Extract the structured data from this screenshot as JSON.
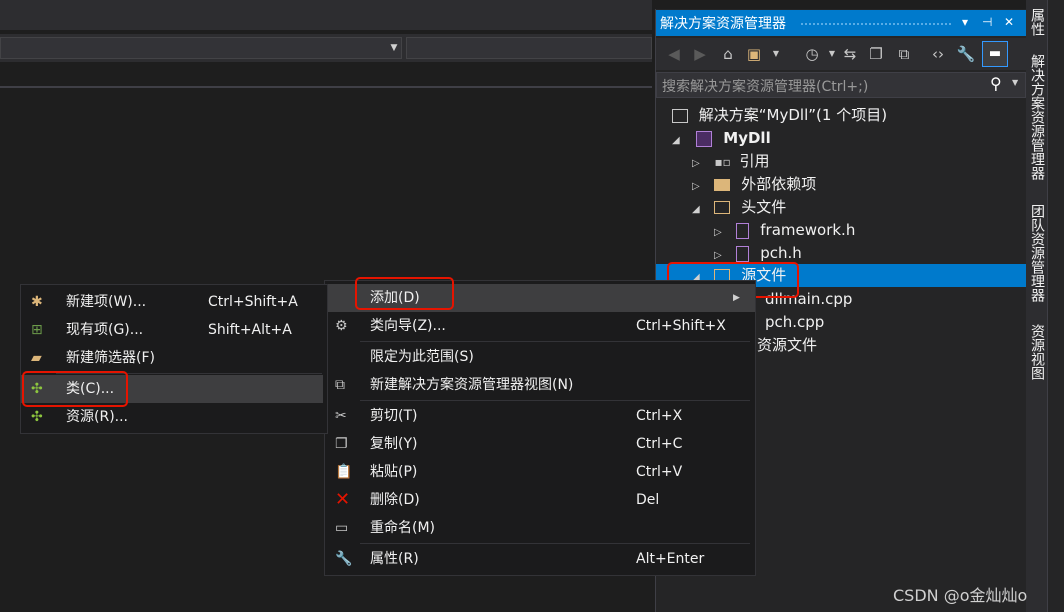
{
  "solution_explorer": {
    "title": "解决方案资源管理器",
    "title_buttons": [
      "▾",
      "⊣",
      "✕"
    ],
    "search_placeholder": "搜索解决方案资源管理器(Ctrl+;)",
    "tree": {
      "solution": "解决方案“MyDll”(1 个项目)",
      "project": "MyDll",
      "references": "引用",
      "external_deps": "外部依赖项",
      "header_files": "头文件",
      "framework_h": "framework.h",
      "pch_h": "pch.h",
      "source_files": "源文件",
      "dllmain_cpp": "dllmain.cpp",
      "pch_cpp": "pch.cpp",
      "resource_files_partial": "资源文件"
    }
  },
  "side_tabs": [
    "属性",
    "解决方案资源管理器",
    "团队资源管理器",
    "资源视图"
  ],
  "context_menu": {
    "add": "添加(D)",
    "class_wizard": {
      "label": "类向导(Z)...",
      "shortcut": "Ctrl+Shift+X"
    },
    "scope_to_this": "限定为此范围(S)",
    "new_view": "新建解决方案资源管理器视图(N)",
    "cut": {
      "label": "剪切(T)",
      "shortcut": "Ctrl+X"
    },
    "copy": {
      "label": "复制(Y)",
      "shortcut": "Ctrl+C"
    },
    "paste": {
      "label": "粘贴(P)",
      "shortcut": "Ctrl+V"
    },
    "delete": {
      "label": "删除(D)",
      "shortcut": "Del"
    },
    "rename": "重命名(M)",
    "properties": {
      "label": "属性(R)",
      "shortcut": "Alt+Enter"
    }
  },
  "add_submenu": {
    "new_item": {
      "label": "新建项(W)...",
      "shortcut": "Ctrl+Shift+A"
    },
    "existing_item": {
      "label": "现有项(G)...",
      "shortcut": "Shift+Alt+A"
    },
    "new_filter": "新建筛选器(F)",
    "class": "类(C)...",
    "resource": "资源(R)..."
  },
  "watermark": "CSDN @o金灿灿o",
  "colors": {
    "accent": "#007acc",
    "highlight_box": "#e51400",
    "menu_bg": "#1b1b1c",
    "selection": "#3e3e40"
  }
}
